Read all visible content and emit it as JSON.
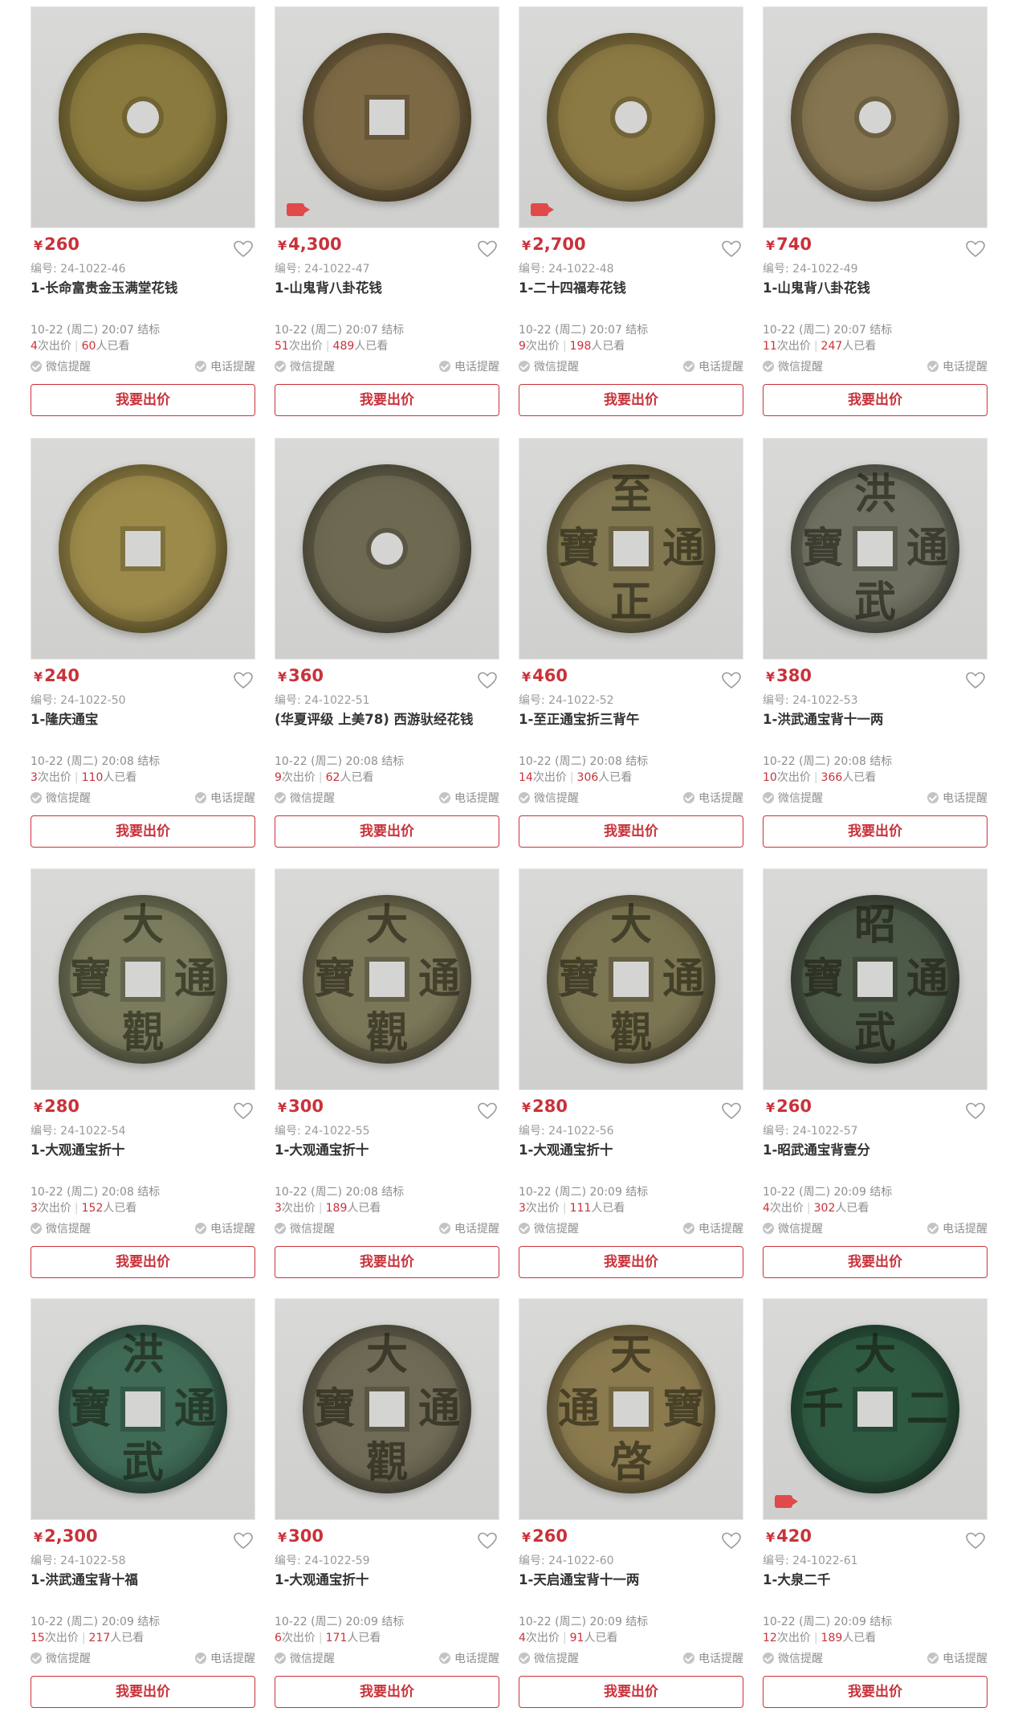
{
  "currency_symbol": "¥",
  "labels": {
    "code_prefix": "编号: ",
    "times_bid": "次出价",
    "viewed": "人已看",
    "wechat_remind": "微信提醒",
    "phone_remind": "电话提醒",
    "bid_button": "我要出价",
    "end_suffix": " 结标"
  },
  "colors": {
    "accent": "#c9323a",
    "muted": "#8e8e8e"
  },
  "items": [
    {
      "price": "260",
      "code": "24-1022-46",
      "title": "1-长命富贵金玉满堂花钱",
      "end_time": "10-22 (周二) 20:07",
      "bids": "4",
      "views": "60",
      "video": false,
      "coin": {
        "color": "#8a7a3e",
        "glyphs": [
          "",
          "",
          "",
          ""
        ],
        "hole": "round"
      }
    },
    {
      "price": "4,300",
      "code": "24-1022-47",
      "title": "1-山鬼背八卦花钱",
      "end_time": "10-22 (周二) 20:07",
      "bids": "51",
      "views": "489",
      "video": true,
      "coin": {
        "color": "#7d6a45",
        "glyphs": [
          "",
          "",
          "",
          ""
        ],
        "hole": "square"
      }
    },
    {
      "price": "2,700",
      "code": "24-1022-48",
      "title": "1-二十四福寿花钱",
      "end_time": "10-22 (周二) 20:07",
      "bids": "9",
      "views": "198",
      "video": true,
      "coin": {
        "color": "#8c7a44",
        "glyphs": [
          "",
          "",
          "",
          ""
        ],
        "hole": "round"
      }
    },
    {
      "price": "740",
      "code": "24-1022-49",
      "title": "1-山鬼背八卦花钱",
      "end_time": "10-22 (周二) 20:07",
      "bids": "11",
      "views": "247",
      "video": false,
      "coin": {
        "color": "#857550",
        "glyphs": [
          "",
          "",
          "",
          ""
        ],
        "hole": "round"
      }
    },
    {
      "price": "240",
      "code": "24-1022-50",
      "title": "1-隆庆通宝",
      "end_time": "10-22 (周二) 20:08",
      "bids": "3",
      "views": "110",
      "video": false,
      "coin": {
        "color": "#9c8a4a",
        "glyphs": [
          "",
          "",
          "",
          ""
        ],
        "hole": "square"
      }
    },
    {
      "price": "360",
      "code": "24-1022-51",
      "title": "(华夏评级 上美78) 西游驮经花钱",
      "end_time": "10-22 (周二) 20:08",
      "bids": "9",
      "views": "62",
      "video": false,
      "coin": {
        "color": "#6e6a52",
        "glyphs": [
          "",
          "",
          "",
          ""
        ],
        "hole": "round"
      }
    },
    {
      "price": "460",
      "code": "24-1022-52",
      "title": "1-至正通宝折三背午",
      "end_time": "10-22 (周二) 20:08",
      "bids": "14",
      "views": "306",
      "video": false,
      "coin": {
        "color": "#807650",
        "glyphs": [
          "至",
          "正",
          "寶",
          "通"
        ],
        "hole": "square"
      }
    },
    {
      "price": "380",
      "code": "24-1022-53",
      "title": "1-洪武通宝背十一两",
      "end_time": "10-22 (周二) 20:08",
      "bids": "10",
      "views": "366",
      "video": false,
      "coin": {
        "color": "#6f7060",
        "glyphs": [
          "洪",
          "武",
          "寶",
          "通"
        ],
        "hole": "square"
      }
    },
    {
      "price": "280",
      "code": "24-1022-54",
      "title": "1-大观通宝折十",
      "end_time": "10-22 (周二) 20:08",
      "bids": "3",
      "views": "152",
      "video": false,
      "coin": {
        "color": "#7b7c5e",
        "glyphs": [
          "大",
          "觀",
          "寶",
          "通"
        ],
        "hole": "square"
      }
    },
    {
      "price": "300",
      "code": "24-1022-55",
      "title": "1-大观通宝折十",
      "end_time": "10-22 (周二) 20:08",
      "bids": "3",
      "views": "189",
      "video": false,
      "coin": {
        "color": "#7a7658",
        "glyphs": [
          "大",
          "觀",
          "寶",
          "通"
        ],
        "hole": "square"
      }
    },
    {
      "price": "280",
      "code": "24-1022-56",
      "title": "1-大观通宝折十",
      "end_time": "10-22 (周二) 20:09",
      "bids": "3",
      "views": "111",
      "video": false,
      "coin": {
        "color": "#7c7552",
        "glyphs": [
          "大",
          "觀",
          "寶",
          "通"
        ],
        "hole": "square"
      }
    },
    {
      "price": "260",
      "code": "24-1022-57",
      "title": "1-昭武通宝背壹分",
      "end_time": "10-22 (周二) 20:09",
      "bids": "4",
      "views": "302",
      "video": false,
      "coin": {
        "color": "#4e5a48",
        "glyphs": [
          "昭",
          "武",
          "寶",
          "通"
        ],
        "hole": "square"
      }
    },
    {
      "price": "2,300",
      "code": "24-1022-58",
      "title": "1-洪武通宝背十福",
      "end_time": "10-22 (周二) 20:09",
      "bids": "15",
      "views": "217",
      "video": false,
      "coin": {
        "color": "#3f6a55",
        "glyphs": [
          "洪",
          "武",
          "寶",
          "通"
        ],
        "hole": "square"
      }
    },
    {
      "price": "300",
      "code": "24-1022-59",
      "title": "1-大观通宝折十",
      "end_time": "10-22 (周二) 20:09",
      "bids": "6",
      "views": "171",
      "video": false,
      "coin": {
        "color": "#6e6a55",
        "glyphs": [
          "大",
          "觀",
          "寶",
          "通"
        ],
        "hole": "square"
      }
    },
    {
      "price": "260",
      "code": "24-1022-60",
      "title": "1-天启通宝背十一两",
      "end_time": "10-22 (周二) 20:09",
      "bids": "4",
      "views": "91",
      "video": false,
      "coin": {
        "color": "#8a7a4e",
        "glyphs": [
          "天",
          "啓",
          "通",
          "寶"
        ],
        "hole": "square"
      }
    },
    {
      "price": "420",
      "code": "24-1022-61",
      "title": "1-大泉二千",
      "end_time": "10-22 (周二) 20:09",
      "bids": "12",
      "views": "189",
      "video": true,
      "coin": {
        "color": "#2f5a42",
        "glyphs": [
          "大",
          "",
          "千",
          "二"
        ],
        "hole": "square"
      }
    }
  ]
}
